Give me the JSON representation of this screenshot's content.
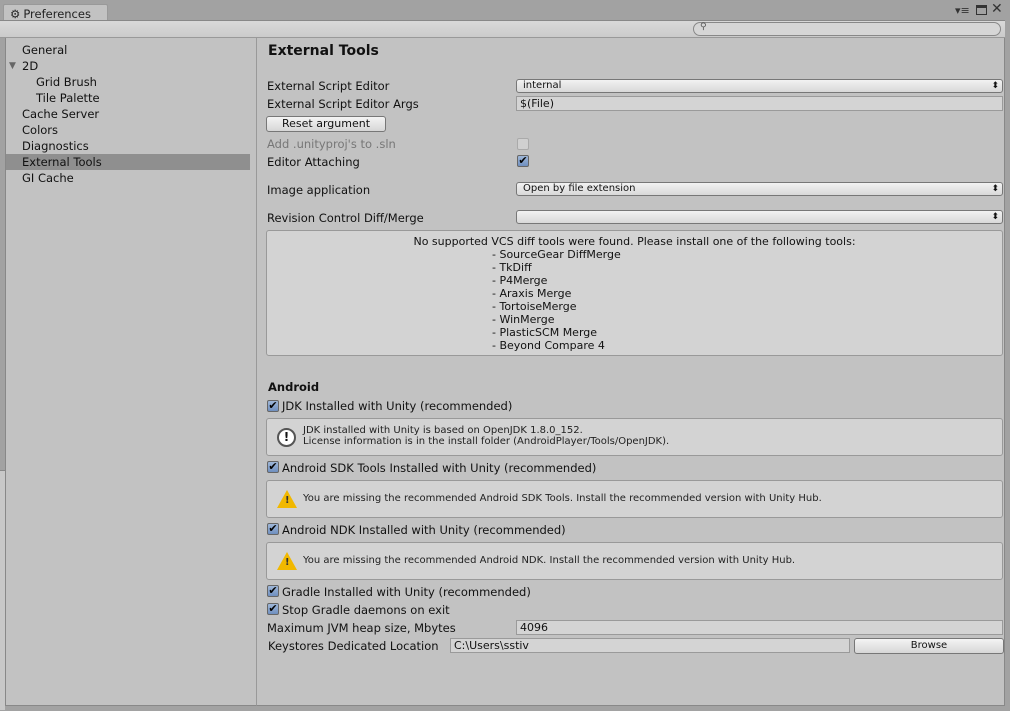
{
  "window": {
    "title": "Preferences",
    "search_placeholder": ""
  },
  "sidebar": {
    "items": [
      {
        "label": "General"
      },
      {
        "label": "2D"
      },
      {
        "label": "Grid Brush"
      },
      {
        "label": "Tile Palette"
      },
      {
        "label": "Cache Server"
      },
      {
        "label": "Colors"
      },
      {
        "label": "Diagnostics"
      },
      {
        "label": "External Tools"
      },
      {
        "label": "GI Cache"
      }
    ]
  },
  "main": {
    "title": "External Tools",
    "script_editor_label": "External Script Editor",
    "script_editor_value": "internal",
    "script_args_label": "External Script Editor Args",
    "script_args_value": "$(File)",
    "reset_label": "Reset argument",
    "add_unityproj_label": "Add .unityproj's to .sln",
    "editor_attaching_label": "Editor Attaching",
    "image_app_label": "Image application",
    "image_app_value": "Open by file extension",
    "revision_label": "Revision Control Diff/Merge",
    "revision_value": "",
    "vcs_message": "No supported VCS diff tools were found. Please install one of the following tools:",
    "vcs_tools": [
      "- SourceGear DiffMerge",
      "- TkDiff",
      "- P4Merge",
      "- Araxis Merge",
      "- TortoiseMerge",
      "- WinMerge",
      "- PlasticSCM Merge",
      "- Beyond Compare 4"
    ],
    "android": {
      "heading": "Android",
      "jdk_label": "JDK Installed with Unity (recommended)",
      "jdk_info_1": "JDK installed with Unity is based on OpenJDK 1.8.0_152.",
      "jdk_info_2": "License information is in the install folder (AndroidPlayer/Tools/OpenJDK).",
      "sdk_label": "Android SDK Tools Installed with Unity (recommended)",
      "sdk_warning": "You are missing the recommended Android SDK Tools. Install the recommended version with Unity Hub.",
      "ndk_label": "Android NDK Installed with Unity (recommended)",
      "ndk_warning": "You are missing the recommended Android NDK. Install the recommended version with Unity Hub.",
      "gradle_label": "Gradle Installed with Unity (recommended)",
      "stop_gradle_label": "Stop Gradle daemons on exit",
      "jvm_label": "Maximum JVM heap size, Mbytes",
      "jvm_value": "4096",
      "keystore_label": "Keystores Dedicated Location",
      "keystore_value": "C:\\Users\\sstiv",
      "browse_label": "Browse"
    }
  }
}
